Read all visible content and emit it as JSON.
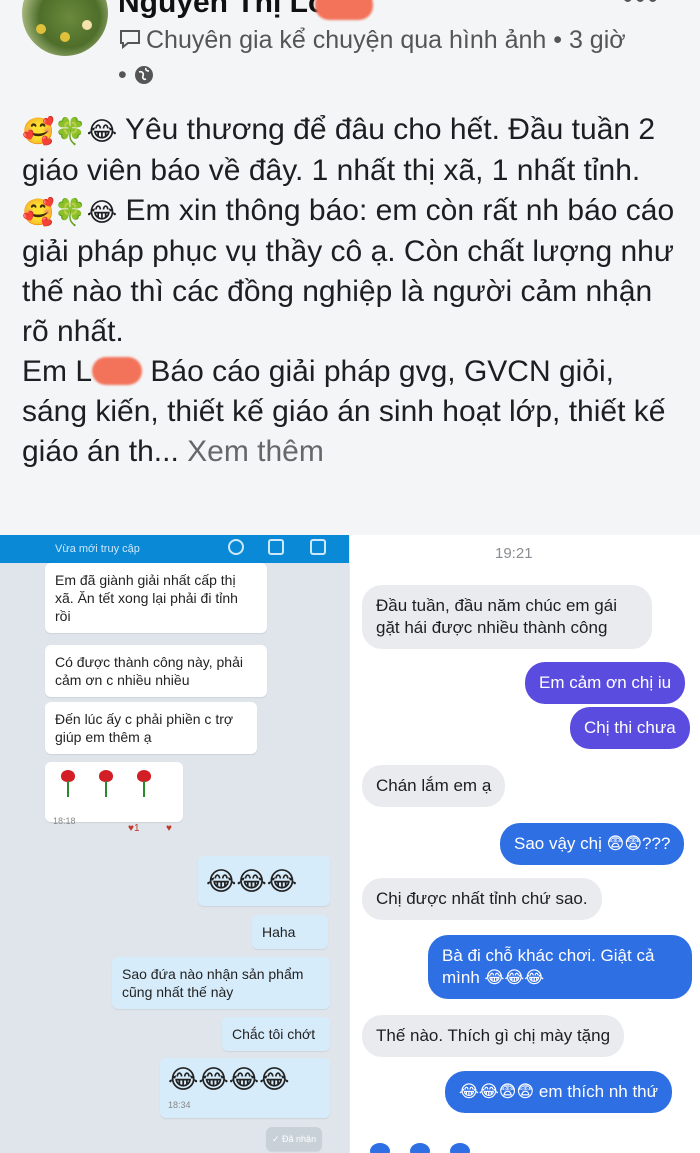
{
  "post": {
    "author": "Nguyễn Thị Lo",
    "meta_line": "Chuyên gia kể chuyện qua hình ảnh • 3 giờ •",
    "more_icon": "more-dots",
    "audience_icon": "globe-icon",
    "paragraph1": "Yêu thương để đâu cho hết. Đầu tuần 2 giáo viên báo về đây. 1 nhất thị xã, 1 nhất tỉnh.",
    "paragraph2": "Em xin thông báo: em còn rất nh báo cáo giải pháp phục vụ thầy cô ạ. Còn chất lượng như thế nào thì các đồng nghiệp là người cảm nhận rõ nhất.",
    "paragraph3_prefix": "Em L",
    "paragraph3": "Báo cáo giải pháp gvg, GVCN giỏi, sáng kiến, thiết kế giáo án sinh hoạt lớp, thiết kế giáo án th...",
    "see_more": "Xem thêm",
    "emoji_prefix": "🥰🍀😂"
  },
  "zalo": {
    "status": "Vừa mới truy cập",
    "messages": [
      {
        "text": "Em đã giành giải nhất cấp thị xã. Ăn tết xong lại phải đi tỉnh rồi"
      },
      {
        "text": "Có được thành công này, phải cảm ơn c nhiều nhiều"
      },
      {
        "text": "Đến lúc ấy c phải phiền c trợ giúp em thêm ạ"
      },
      {
        "time": "18:18",
        "reaction": "♥1"
      },
      {
        "text": "😂😂😂"
      },
      {
        "text": "Haha"
      },
      {
        "text": "Sao đứa nào nhận sản phẩm cũng nhất thế này"
      },
      {
        "text": "Chắc tôi chớt"
      },
      {
        "text": "😂😂😂😂",
        "time": "18:34"
      }
    ],
    "received": "✓ Đã nhận"
  },
  "messenger": {
    "time": "19:21",
    "messages": [
      {
        "text": "Đầu tuần, đầu năm chúc em gái gặt hái được nhiều thành công"
      },
      {
        "text": "Em cảm ơn chị iu"
      },
      {
        "text": "Chị thi chưa"
      },
      {
        "text": "Chán lắm em ạ"
      },
      {
        "text": "Sao vậy chị 😨😨???"
      },
      {
        "text": "Chị được nhất tỉnh chứ sao."
      },
      {
        "text": "Bà đi chỗ khác chơi. Giật cả mình 😂😂😂"
      },
      {
        "text": "Thế nào. Thích gì chị mày tặng"
      },
      {
        "text": "😂😂😨😨 em thích nh thứ"
      }
    ]
  },
  "colors": {
    "zalo_blue": "#0a89d6",
    "messenger_purple": "#5b4ce0",
    "messenger_blue": "#2f6fe4"
  }
}
